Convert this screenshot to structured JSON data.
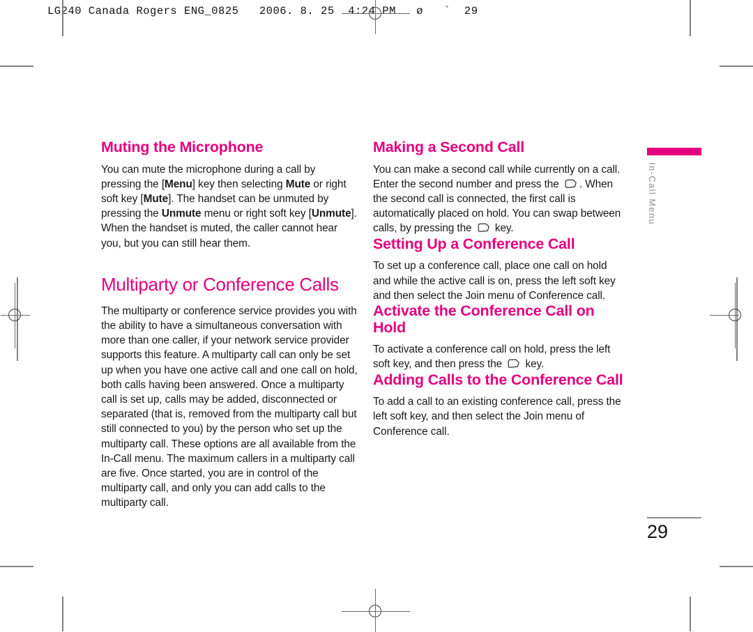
{
  "prepress": {
    "slug": "LG240 Canada Rogers ENG_0825   2006. 8. 25  4:24 PM   ø   `  29"
  },
  "page": {
    "folio": "29",
    "tab_label": "In-Call Menu",
    "accent_color": "#e4007e",
    "rule_color": "#8d8d8d"
  },
  "left_column": {
    "section1": {
      "heading": "Muting the Microphone",
      "paragraph": {
        "p1": "You can mute the microphone during a call by pressing the [",
        "b1": "Menu",
        "p2": "] key then selecting ",
        "b2": "Mute",
        "p3": " or right soft key [",
        "b3": "Mute",
        "p4": "]. The handset can be unmuted by pressing the ",
        "b4": "Unmute",
        "p5": " menu or right soft key [",
        "b5": "Unmute",
        "p6": "]. When the handset is muted, the caller cannot hear you, but you can still hear them."
      }
    },
    "section2": {
      "heading": "Multiparty or Conference Calls",
      "paragraph": "The multiparty or conference service provides you with the ability to have a simultaneous conversation with more than one caller, if your network service provider supports this feature. A multiparty call can only be set up when you have one active call and one call on hold, both calls having been answered. Once a multiparty call is set up, calls may be added, disconnected or separated (that is, removed from the multiparty call but still connected to you) by the person who set up the multiparty call. These options are all available from the In-Call menu. The maximum callers in a multiparty call are five. Once started, you are in control of the multiparty call, and only you can add calls to the multiparty call."
    }
  },
  "right_column": {
    "section1": {
      "heading": "Making a Second Call",
      "paragraph": {
        "p1": "You can make a second call while currently on a call. Enter the second number and press the ",
        "icon1": "send-key-icon",
        "p2": ". When the second call is connected, the first call is automatically placed on hold. You can swap between calls, by pressing the ",
        "icon2": "send-key-icon",
        "p3": " key."
      }
    },
    "section2": {
      "heading": "Setting Up a Conference Call",
      "paragraph": "To set up a conference call, place one call on hold and while the active call is on, press the left soft key and then select the Join menu of Conference call."
    },
    "section3": {
      "heading": "Activate the Conference Call on Hold",
      "paragraph": {
        "p1": "To activate a conference call on hold, press the left soft key, and then press the ",
        "icon1": "send-key-icon",
        "p2": " key."
      }
    },
    "section4": {
      "heading": "Adding Calls to the Conference Call",
      "paragraph": "To add a call to an existing conference call, press the left soft key, and then select the Join menu of Conference call."
    }
  }
}
